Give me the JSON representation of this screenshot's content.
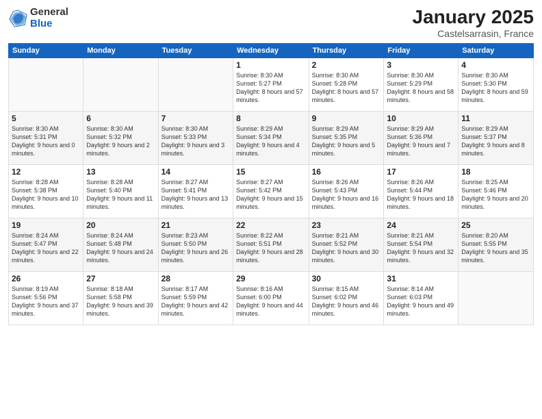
{
  "logo": {
    "general": "General",
    "blue": "Blue"
  },
  "header": {
    "title": "January 2025",
    "subtitle": "Castelsarrasin, France"
  },
  "weekdays": [
    "Sunday",
    "Monday",
    "Tuesday",
    "Wednesday",
    "Thursday",
    "Friday",
    "Saturday"
  ],
  "weeks": [
    [
      {
        "day": "",
        "info": ""
      },
      {
        "day": "",
        "info": ""
      },
      {
        "day": "",
        "info": ""
      },
      {
        "day": "1",
        "info": "Sunrise: 8:30 AM\nSunset: 5:27 PM\nDaylight: 8 hours and 57 minutes."
      },
      {
        "day": "2",
        "info": "Sunrise: 8:30 AM\nSunset: 5:28 PM\nDaylight: 8 hours and 57 minutes."
      },
      {
        "day": "3",
        "info": "Sunrise: 8:30 AM\nSunset: 5:29 PM\nDaylight: 8 hours and 58 minutes."
      },
      {
        "day": "4",
        "info": "Sunrise: 8:30 AM\nSunset: 5:30 PM\nDaylight: 8 hours and 59 minutes."
      }
    ],
    [
      {
        "day": "5",
        "info": "Sunrise: 8:30 AM\nSunset: 5:31 PM\nDaylight: 9 hours and 0 minutes."
      },
      {
        "day": "6",
        "info": "Sunrise: 8:30 AM\nSunset: 5:32 PM\nDaylight: 9 hours and 2 minutes."
      },
      {
        "day": "7",
        "info": "Sunrise: 8:30 AM\nSunset: 5:33 PM\nDaylight: 9 hours and 3 minutes."
      },
      {
        "day": "8",
        "info": "Sunrise: 8:29 AM\nSunset: 5:34 PM\nDaylight: 9 hours and 4 minutes."
      },
      {
        "day": "9",
        "info": "Sunrise: 8:29 AM\nSunset: 5:35 PM\nDaylight: 9 hours and 5 minutes."
      },
      {
        "day": "10",
        "info": "Sunrise: 8:29 AM\nSunset: 5:36 PM\nDaylight: 9 hours and 7 minutes."
      },
      {
        "day": "11",
        "info": "Sunrise: 8:29 AM\nSunset: 5:37 PM\nDaylight: 9 hours and 8 minutes."
      }
    ],
    [
      {
        "day": "12",
        "info": "Sunrise: 8:28 AM\nSunset: 5:38 PM\nDaylight: 9 hours and 10 minutes."
      },
      {
        "day": "13",
        "info": "Sunrise: 8:28 AM\nSunset: 5:40 PM\nDaylight: 9 hours and 11 minutes."
      },
      {
        "day": "14",
        "info": "Sunrise: 8:27 AM\nSunset: 5:41 PM\nDaylight: 9 hours and 13 minutes."
      },
      {
        "day": "15",
        "info": "Sunrise: 8:27 AM\nSunset: 5:42 PM\nDaylight: 9 hours and 15 minutes."
      },
      {
        "day": "16",
        "info": "Sunrise: 8:26 AM\nSunset: 5:43 PM\nDaylight: 9 hours and 16 minutes."
      },
      {
        "day": "17",
        "info": "Sunrise: 8:26 AM\nSunset: 5:44 PM\nDaylight: 9 hours and 18 minutes."
      },
      {
        "day": "18",
        "info": "Sunrise: 8:25 AM\nSunset: 5:46 PM\nDaylight: 9 hours and 20 minutes."
      }
    ],
    [
      {
        "day": "19",
        "info": "Sunrise: 8:24 AM\nSunset: 5:47 PM\nDaylight: 9 hours and 22 minutes."
      },
      {
        "day": "20",
        "info": "Sunrise: 8:24 AM\nSunset: 5:48 PM\nDaylight: 9 hours and 24 minutes."
      },
      {
        "day": "21",
        "info": "Sunrise: 8:23 AM\nSunset: 5:50 PM\nDaylight: 9 hours and 26 minutes."
      },
      {
        "day": "22",
        "info": "Sunrise: 8:22 AM\nSunset: 5:51 PM\nDaylight: 9 hours and 28 minutes."
      },
      {
        "day": "23",
        "info": "Sunrise: 8:21 AM\nSunset: 5:52 PM\nDaylight: 9 hours and 30 minutes."
      },
      {
        "day": "24",
        "info": "Sunrise: 8:21 AM\nSunset: 5:54 PM\nDaylight: 9 hours and 32 minutes."
      },
      {
        "day": "25",
        "info": "Sunrise: 8:20 AM\nSunset: 5:55 PM\nDaylight: 9 hours and 35 minutes."
      }
    ],
    [
      {
        "day": "26",
        "info": "Sunrise: 8:19 AM\nSunset: 5:56 PM\nDaylight: 9 hours and 37 minutes."
      },
      {
        "day": "27",
        "info": "Sunrise: 8:18 AM\nSunset: 5:58 PM\nDaylight: 9 hours and 39 minutes."
      },
      {
        "day": "28",
        "info": "Sunrise: 8:17 AM\nSunset: 5:59 PM\nDaylight: 9 hours and 42 minutes."
      },
      {
        "day": "29",
        "info": "Sunrise: 8:16 AM\nSunset: 6:00 PM\nDaylight: 9 hours and 44 minutes."
      },
      {
        "day": "30",
        "info": "Sunrise: 8:15 AM\nSunset: 6:02 PM\nDaylight: 9 hours and 46 minutes."
      },
      {
        "day": "31",
        "info": "Sunrise: 8:14 AM\nSunset: 6:03 PM\nDaylight: 9 hours and 49 minutes."
      },
      {
        "day": "",
        "info": ""
      }
    ]
  ]
}
